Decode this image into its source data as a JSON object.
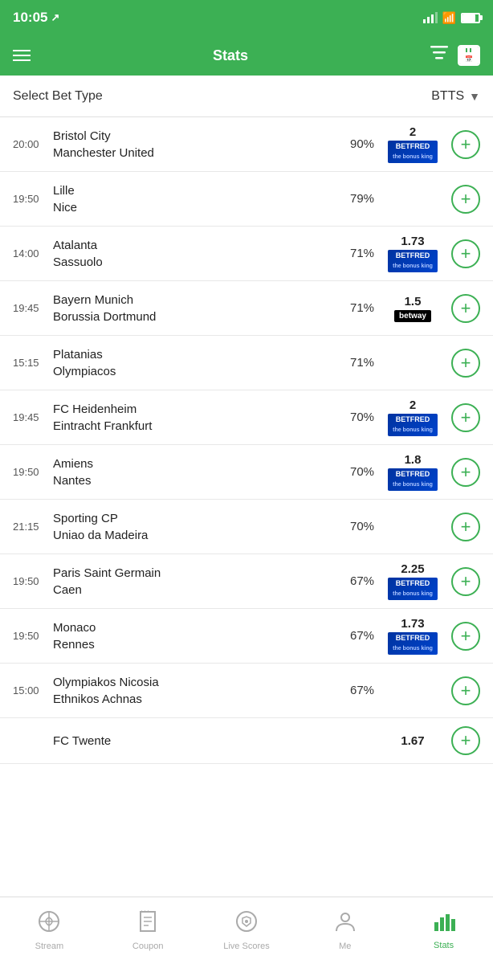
{
  "statusBar": {
    "time": "10:05",
    "locationIcon": "↗"
  },
  "navBar": {
    "title": "Stats",
    "filterIcon": "≡",
    "calendarIcon": "📅"
  },
  "betTypeSelector": {
    "label": "Select Bet Type",
    "value": "BTTS"
  },
  "matches": [
    {
      "time": "20:00",
      "home": "Bristol City",
      "away": "Manchester United",
      "pct": "90%",
      "odds": "2",
      "badge": "betfred"
    },
    {
      "time": "19:50",
      "home": "Lille",
      "away": "Nice",
      "pct": "79%",
      "odds": "",
      "badge": ""
    },
    {
      "time": "14:00",
      "home": "Atalanta",
      "away": "Sassuolo",
      "pct": "71%",
      "odds": "1.73",
      "badge": "betfred"
    },
    {
      "time": "19:45",
      "home": "Bayern Munich",
      "away": "Borussia Dortmund",
      "pct": "71%",
      "odds": "1.5",
      "badge": "betway"
    },
    {
      "time": "15:15",
      "home": "Platanias",
      "away": "Olympiacos",
      "pct": "71%",
      "odds": "",
      "badge": ""
    },
    {
      "time": "19:45",
      "home": "FC Heidenheim",
      "away": "Eintracht Frankfurt",
      "pct": "70%",
      "odds": "2",
      "badge": "betfred"
    },
    {
      "time": "19:50",
      "home": "Amiens",
      "away": "Nantes",
      "pct": "70%",
      "odds": "1.8",
      "badge": "betfred"
    },
    {
      "time": "21:15",
      "home": "Sporting CP",
      "away": "Uniao da Madeira",
      "pct": "70%",
      "odds": "",
      "badge": ""
    },
    {
      "time": "19:50",
      "home": "Paris Saint Germain",
      "away": "Caen",
      "pct": "67%",
      "odds": "2.25",
      "badge": "betfred"
    },
    {
      "time": "19:50",
      "home": "Monaco",
      "away": "Rennes",
      "pct": "67%",
      "odds": "1.73",
      "badge": "betfred"
    },
    {
      "time": "15:00",
      "home": "Olympiakos Nicosia",
      "away": "Ethnikos Achnas",
      "pct": "67%",
      "odds": "",
      "badge": ""
    },
    {
      "time": "",
      "home": "FC Twente",
      "away": "",
      "pct": "",
      "odds": "1.67",
      "badge": ""
    }
  ],
  "bottomNav": {
    "items": [
      {
        "label": "Stream",
        "icon": "stream",
        "active": false
      },
      {
        "label": "Coupon",
        "icon": "coupon",
        "active": false
      },
      {
        "label": "Live Scores",
        "icon": "live",
        "active": false
      },
      {
        "label": "Me",
        "icon": "me",
        "active": false
      },
      {
        "label": "Stats",
        "icon": "stats",
        "active": true
      }
    ]
  }
}
